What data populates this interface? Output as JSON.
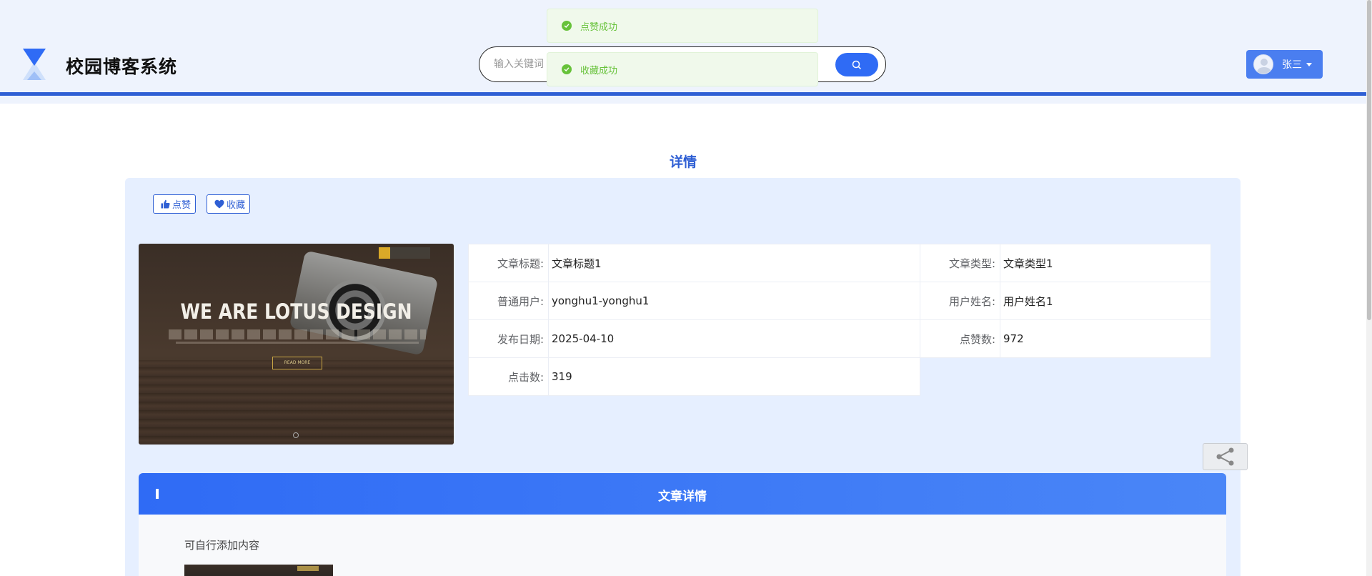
{
  "header": {
    "site_title": "校园博客系统",
    "search_placeholder": "输入关键词",
    "user_name": "张三"
  },
  "toasts": [
    {
      "text": "点赞成功"
    },
    {
      "text": "收藏成功"
    }
  ],
  "page": {
    "title": "详情",
    "like_label": "点赞",
    "favorite_label": "收藏"
  },
  "cover_image": {
    "headline": "WE ARE LOTUS DESIGN",
    "button_text": "READ MORE"
  },
  "info": {
    "rows": [
      [
        {
          "label": "文章标题:",
          "value": "文章标题1"
        },
        {
          "label": "文章类型:",
          "value": "文章类型1"
        }
      ],
      [
        {
          "label": "普通用户:",
          "value": "yonghu1-yonghu1"
        },
        {
          "label": "用户姓名:",
          "value": "用户姓名1"
        }
      ],
      [
        {
          "label": "发布日期:",
          "value": "2025-04-10"
        },
        {
          "label": "点赞数:",
          "value": "972"
        }
      ],
      [
        {
          "label": "点击数:",
          "value": "319"
        }
      ]
    ]
  },
  "detail": {
    "title": "文章详情",
    "content": "可自行添加内容"
  },
  "colors": {
    "primary": "#2f5fd4",
    "button": "#2f6bf5",
    "success": "#67c23a",
    "panel": "#e6efff"
  }
}
